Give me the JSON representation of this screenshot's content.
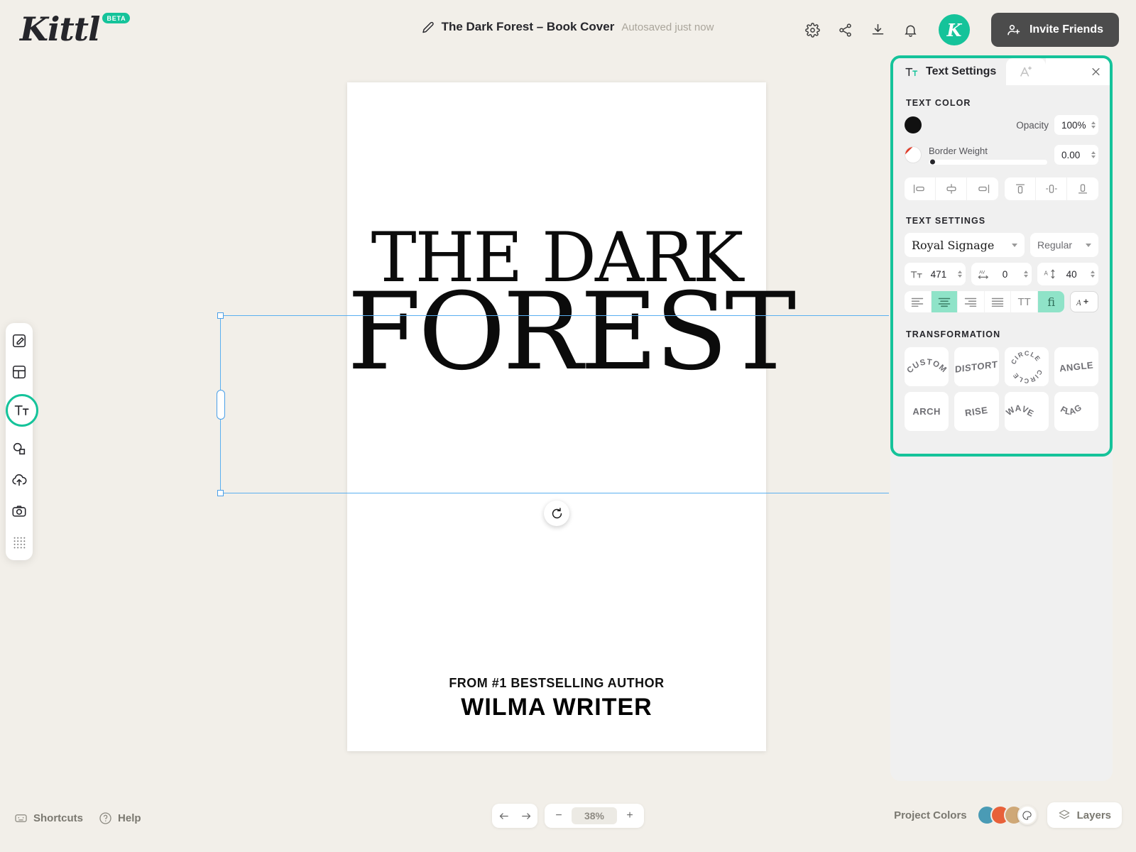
{
  "app": {
    "brand": "Kittl",
    "brand_badge": "BETA",
    "accent": "#15c39a",
    "background": "#f2efe9"
  },
  "header": {
    "doc_title": "The Dark Forest – Book Cover",
    "autosave": "Autosaved just now",
    "icons": [
      "gear-icon",
      "share-icon",
      "download-icon",
      "bell-icon"
    ],
    "avatar_letter": "K",
    "invite_label": "Invite Friends"
  },
  "left_toolbar": {
    "items": [
      {
        "name": "design-tool",
        "label": "Design"
      },
      {
        "name": "templates-tool",
        "label": "Templates"
      },
      {
        "name": "text-tool",
        "label": "Text",
        "active": true
      },
      {
        "name": "elements-tool",
        "label": "Elements"
      },
      {
        "name": "uploads-tool",
        "label": "Uploads"
      },
      {
        "name": "photos-tool",
        "label": "Photos"
      },
      {
        "name": "patterns-tool",
        "label": "Patterns"
      }
    ]
  },
  "canvas": {
    "cover_title_line1": "THE DARK",
    "cover_title_line2": "FOREST",
    "cover_from": "FROM #1 BESTSELLING AUTHOR",
    "cover_author": "WILMA WRITER"
  },
  "panel": {
    "tab_label": "Text Settings",
    "tab2_icon": "effects-icon",
    "close_icon": "close-icon",
    "text_color": {
      "section_label": "TEXT COLOR",
      "fill_hex": "#111111",
      "opacity_label": "Opacity",
      "opacity_value": "100%",
      "border_label": "Border Weight",
      "border_value": "0.00"
    },
    "align_buttons": [
      {
        "name": "align-left-icon",
        "label": "Align left"
      },
      {
        "name": "align-center-horizontal-icon",
        "label": "Align center"
      },
      {
        "name": "align-right-icon",
        "label": "Align right"
      },
      {
        "name": "align-top-icon",
        "label": "Align top"
      },
      {
        "name": "align-middle-vertical-icon",
        "label": "Align middle"
      },
      {
        "name": "align-bottom-icon",
        "label": "Align bottom"
      }
    ],
    "text_settings": {
      "section_label": "TEXT SETTINGS",
      "font_family": "Royal Signage",
      "font_weight": "Regular",
      "font_size": "471",
      "letter_spacing": "0",
      "line_height": "40",
      "style_buttons": [
        {
          "name": "text-align-left-icon",
          "active": false
        },
        {
          "name": "text-align-center-icon",
          "active": true
        },
        {
          "name": "text-align-right-icon",
          "active": false
        },
        {
          "name": "text-align-justify-icon",
          "active": false
        },
        {
          "name": "uppercase-icon",
          "label": "TT",
          "active": false
        },
        {
          "name": "ligature-icon",
          "label": "fi",
          "active": true
        }
      ],
      "special_button": {
        "name": "alternate-glyphs-icon",
        "label": "A+"
      }
    },
    "transformation": {
      "section_label": "TRANSFORMATION",
      "items": [
        {
          "name": "transform-custom",
          "label": "CUSTOM",
          "style": "arc"
        },
        {
          "name": "transform-distort",
          "label": "DISTORT",
          "style": "skew"
        },
        {
          "name": "transform-circle",
          "label": "CIRCLE",
          "style": "circle"
        },
        {
          "name": "transform-angle",
          "label": "ANGLE",
          "style": "angle"
        },
        {
          "name": "transform-arch",
          "label": "ARCH",
          "style": "flat"
        },
        {
          "name": "transform-rise",
          "label": "RISE",
          "style": "rise"
        },
        {
          "name": "transform-wave",
          "label": "WAVE",
          "style": "wave"
        },
        {
          "name": "transform-flag",
          "label": "FLAG",
          "style": "flag"
        }
      ]
    }
  },
  "bottom": {
    "shortcuts_label": "Shortcuts",
    "help_label": "Help",
    "undo_icon": "undo-icon",
    "redo_icon": "redo-icon",
    "zoom_out": "−",
    "zoom_value": "38%",
    "zoom_in": "+",
    "project_colors_label": "Project Colors",
    "project_colors": [
      "#4a9bb5",
      "#e8613a",
      "#cfa877"
    ],
    "palette_icon": "palette-icon",
    "layers_label": "Layers"
  }
}
